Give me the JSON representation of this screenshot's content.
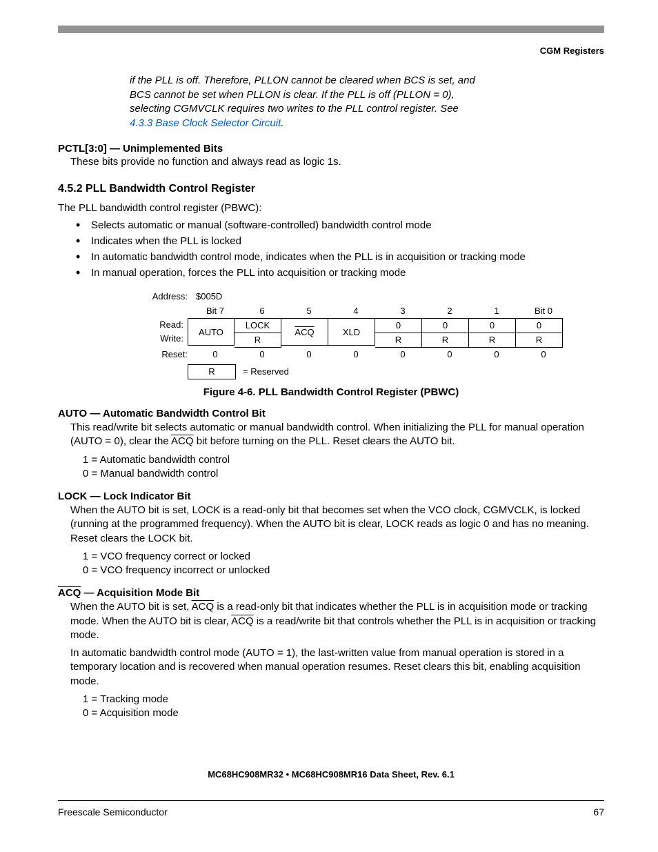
{
  "header": {
    "section": "CGM Registers"
  },
  "note": {
    "line1": "if the PLL is off. Therefore, PLLON cannot be cleared when BCS is set, and",
    "line2": "BCS cannot be set when PLLON is clear. If the PLL is off (PLLON = 0),",
    "line3": "selecting CGMVCLK requires two writes to the PLL control register. See",
    "link": "4.3.3 Base Clock Selector Circuit",
    "period": "."
  },
  "pctl": {
    "head": "PCTL[3:0] — Unimplemented Bits",
    "body": "These bits provide no function and always read as logic 1s."
  },
  "section": {
    "num_title": "4.5.2  PLL Bandwidth Control Register",
    "intro": "The PLL bandwidth control register (PBWC):",
    "bullets": [
      "Selects automatic or manual (software-controlled) bandwidth control mode",
      "Indicates when the PLL is locked",
      "In automatic bandwidth control mode, indicates when the PLL is in acquisition or tracking mode",
      "In manual operation, forces the PLL into acquisition or tracking mode"
    ]
  },
  "register": {
    "addr_label": "Address:",
    "addr_val": "$005D",
    "bit_headers": [
      "Bit 7",
      "6",
      "5",
      "4",
      "3",
      "2",
      "1",
      "Bit 0"
    ],
    "rows": {
      "read_label": "Read:",
      "write_label": "Write:",
      "reset_label": "Reset:"
    },
    "auto": "AUTO",
    "lock": "LOCK",
    "acq_overline": "ACQ",
    "xld": "XLD",
    "zero": "0",
    "R": "R",
    "reset_vals": [
      "0",
      "0",
      "0",
      "0",
      "0",
      "0",
      "0",
      "0"
    ],
    "legend_R": "R",
    "legend_text": "= Reserved",
    "caption": "Figure 4-6. PLL Bandwidth Control Register (PBWC)"
  },
  "bits": {
    "auto": {
      "head": "AUTO — Automatic Bandwidth Control Bit",
      "body_pre": "This read/write bit selects automatic or manual bandwidth control. When initializing the PLL for manual operation (AUTO = 0), clear the ",
      "body_acq": "ACQ",
      "body_post": " bit before turning on the PLL. Reset clears the AUTO bit.",
      "v1": "1 = Automatic bandwidth control",
      "v0": "0 = Manual bandwidth control"
    },
    "lock": {
      "head": "LOCK — Lock Indicator Bit",
      "body": "When the AUTO bit is set, LOCK is a read-only bit that becomes set when the VCO clock, CGMVCLK, is locked (running at the programmed frequency). When the AUTO bit is clear, LOCK reads as logic 0 and has no meaning. Reset clears the LOCK bit.",
      "v1": "1 = VCO frequency correct or locked",
      "v0": "0 = VCO frequency incorrect or unlocked"
    },
    "acq": {
      "head_pre": "ACQ",
      "head_post": " — Acquisition Mode Bit",
      "body1_pre": "When the AUTO bit is set, ",
      "body1_acq": "ACQ",
      "body1_mid": " is a read-only bit that indicates whether the PLL is in acquisition mode or tracking mode. When the AUTO bit is clear, ",
      "body1_acq2": "ACQ",
      "body1_post": " is a read/write bit that controls whether the PLL is in acquisition or tracking mode.",
      "body2": "In automatic bandwidth control mode (AUTO = 1), the last-written value from manual operation is stored in a temporary location and is recovered when manual operation resumes. Reset clears this bit, enabling acquisition mode.",
      "v1": "1 = Tracking mode",
      "v0": "0 = Acquisition mode"
    }
  },
  "footer": {
    "doc_rev": "MC68HC908MR32 • MC68HC908MR16 Data Sheet, Rev. 6.1",
    "vendor": "Freescale Semiconductor",
    "page": "67"
  }
}
